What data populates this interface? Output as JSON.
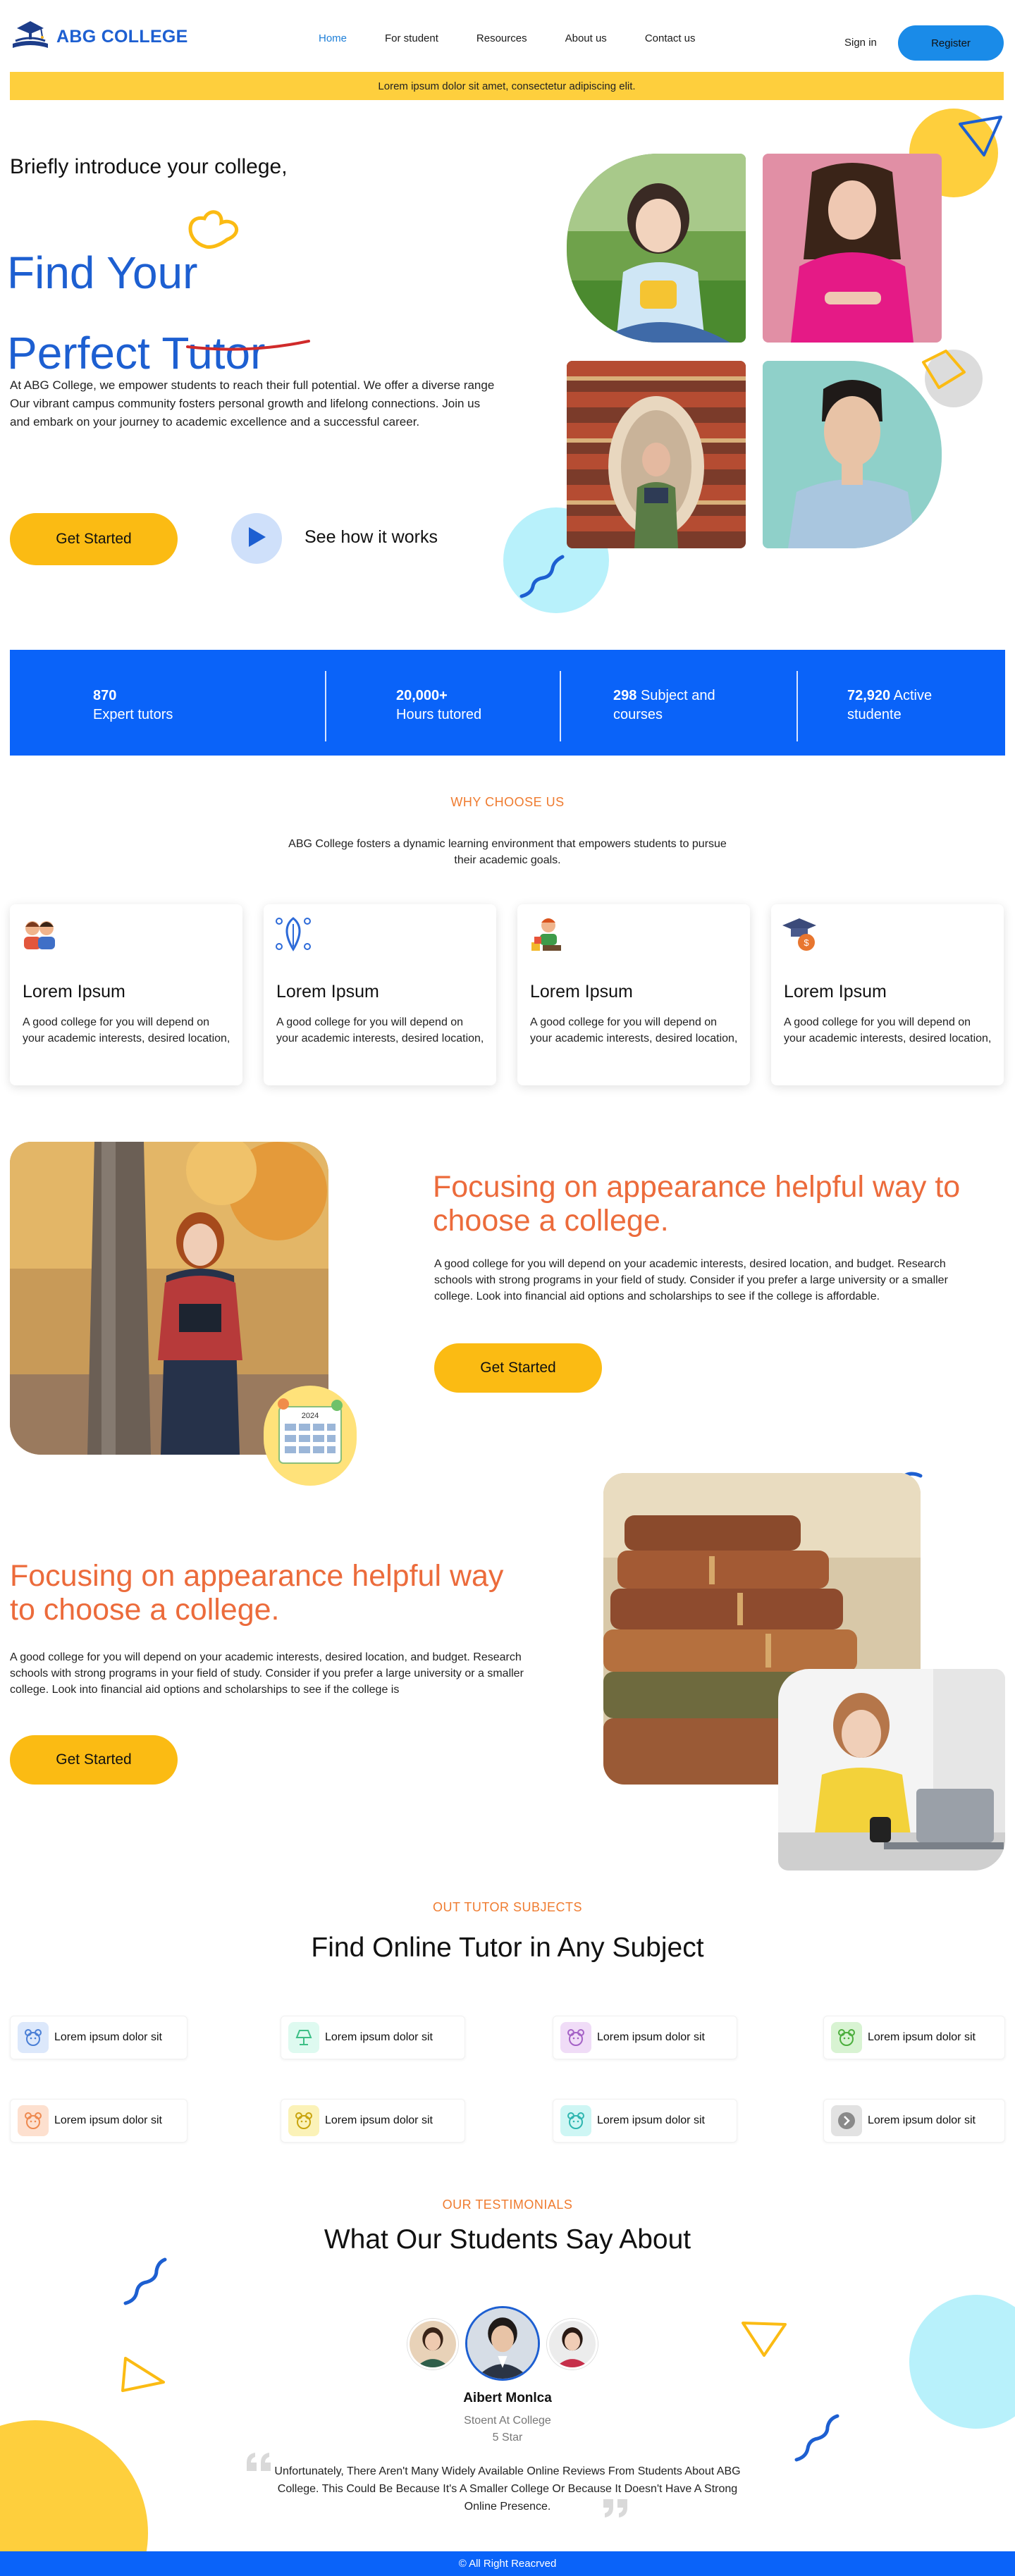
{
  "colors": {
    "brand_blue": "#1d5fd1",
    "accent_yellow": "#fbbb13",
    "banner_yellow": "#fecf3d",
    "accent_orange": "#ec6b3b",
    "stats_blue": "#0a63f9",
    "register_blue": "#1a8be8"
  },
  "nav": {
    "logo_text": "ABG COLLEGE",
    "logo_icon": "graduation-cap-books-icon",
    "menu": [
      {
        "label": "Home",
        "active": true
      },
      {
        "label": "For student",
        "active": false
      },
      {
        "label": "Resources",
        "active": false
      },
      {
        "label": "About  us",
        "active": false
      },
      {
        "label": "Contact us",
        "active": false
      }
    ],
    "signin": "Sign in",
    "register": "Register"
  },
  "banner": {
    "text": "Lorem ipsum dolor sit amet, consectetur adipiscing elit."
  },
  "hero": {
    "intro": "Briefly introduce your college,",
    "title_line1": "Find Your",
    "title_line2": "Perfect Tutor",
    "description": "At ABG College, we empower students to reach their full potential. We offer a diverse range Our vibrant campus community fosters personal growth and lifelong connections. Join us and embark on your journey to academic excellence and a successful career.",
    "cta": "Get Started",
    "secondary_cta": "See how it works"
  },
  "stats": [
    {
      "value": "870",
      "label": "Expert tutors"
    },
    {
      "value": "20,000+",
      "label": "Hours tutored"
    },
    {
      "value": "298",
      "label": "Subject and courses"
    },
    {
      "value": "72,920",
      "label": "Active studente"
    }
  ],
  "why": {
    "eyebrow": "WHY CHOOSE US",
    "description": "ABG College fosters a dynamic learning environment that empowers students to pursue their academic goals.",
    "cards": [
      {
        "icon": "students-icon",
        "title": "Lorem Ipsum",
        "text": "A good college for you will depend on your academic interests, desired location,"
      },
      {
        "icon": "leaf-brain-icon",
        "title": "Lorem Ipsum",
        "text": "A good college for you will depend on your academic interests, desired location,"
      },
      {
        "icon": "teacher-icon",
        "title": "Lorem Ipsum",
        "text": "A good college for you will depend on your academic interests, desired location,"
      },
      {
        "icon": "graduation-money-icon",
        "title": "Lorem Ipsum",
        "text": "A good college for you will depend on your academic interests, desired location,"
      }
    ]
  },
  "feature1": {
    "title": "Focusing on appearance  helpful way to choose a college.",
    "text": "A good college for you will depend on your academic interests, desired location, and budget. Research schools with strong programs in your field of study. Consider if you prefer a large university or a smaller college. Look into financial aid options and scholarships to see if the college is affordable.",
    "cta": "Get Started",
    "calendar_year": "2024"
  },
  "feature2": {
    "title": "Focusing on appearance  helpful way to choose a college.",
    "text": "A good college for you will depend on your academic interests, desired location, and budget. Research schools with strong programs in your field of study. Consider if you prefer a large university or a smaller college. Look into financial aid options and scholarships to see if the college is",
    "cta": "Get Started"
  },
  "subjects": {
    "eyebrow": "OUT TUTOR SUBJECTS",
    "title": "Find Online Tutor in Any Subject",
    "items": [
      {
        "label": "Lorem ipsum dolor sit",
        "icon": "bear-icon",
        "bg": "#dce8fb",
        "fg": "#4a7fd6"
      },
      {
        "label": "Lorem ipsum dolor sit",
        "icon": "lamp-icon",
        "bg": "#defaf0",
        "fg": "#3cbf86"
      },
      {
        "label": "Lorem ipsum dolor sit",
        "icon": "bear-icon",
        "bg": "#f0dcf7",
        "fg": "#a462c6"
      },
      {
        "label": "Lorem ipsum dolor sit",
        "icon": "bear-icon",
        "bg": "#d8f3d2",
        "fg": "#4cae3d"
      },
      {
        "label": "Lorem ipsum dolor sit",
        "icon": "bear-icon",
        "bg": "#fde0cf",
        "fg": "#ee8a50"
      },
      {
        "label": "Lorem ipsum dolor sit",
        "icon": "bear-icon",
        "bg": "#fbf2b8",
        "fg": "#c9a40e"
      },
      {
        "label": "Lorem ipsum dolor sit",
        "icon": "bear-icon",
        "bg": "#cef6f4",
        "fg": "#2eb6b0"
      },
      {
        "label": "Lorem ipsum dolor sit",
        "icon": "arrow-icon",
        "bg": "#e2e2e2",
        "fg": "#8a8a8a"
      }
    ]
  },
  "testimonials": {
    "eyebrow": "OUR TESTIMONIALS",
    "title": "What Our Students Say About",
    "name": "Aibert Monlca",
    "role": "Stoent At College",
    "rating": "5 Star",
    "quote": "Unfortunately, There Aren't Many Widely Available Online Reviews From Students About ABG College. This Could Be Because It's A Smaller College Or Because It Doesn't Have A Strong Online Presence."
  },
  "footer": {
    "text": "© All Right Reacrved"
  }
}
